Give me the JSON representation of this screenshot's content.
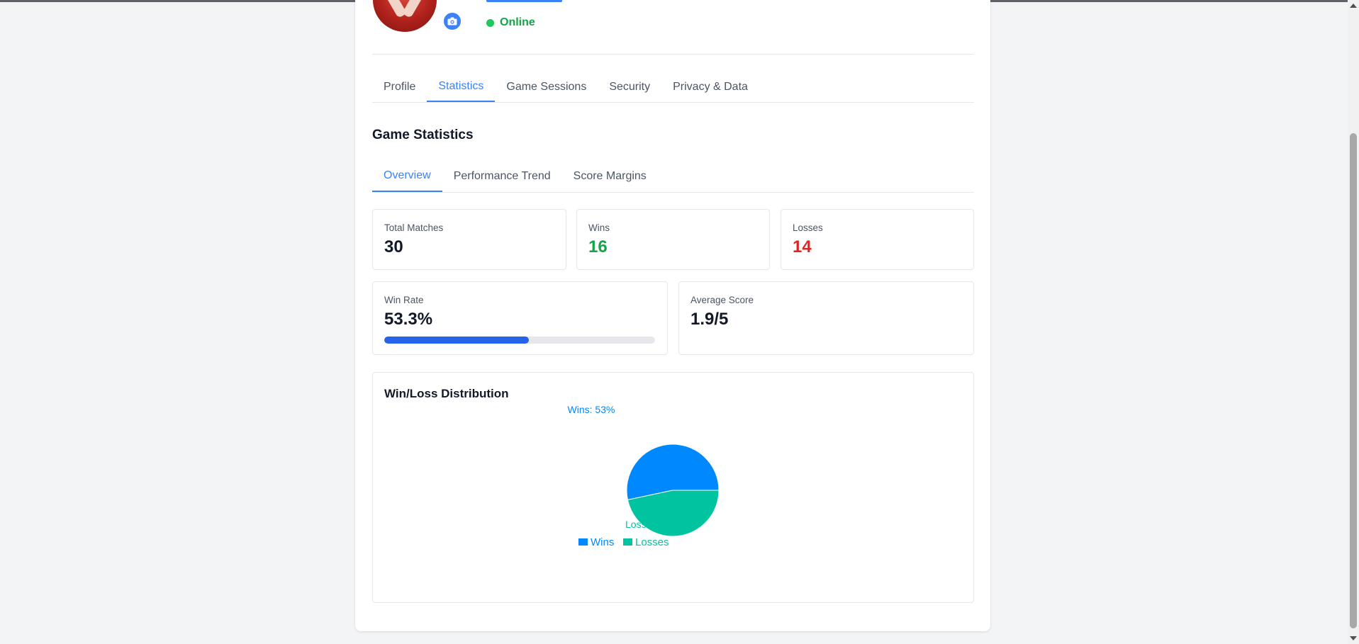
{
  "status": {
    "text": "Online"
  },
  "tabs": [
    {
      "label": "Profile",
      "active": false
    },
    {
      "label": "Statistics",
      "active": true
    },
    {
      "label": "Game Sessions",
      "active": false
    },
    {
      "label": "Security",
      "active": false
    },
    {
      "label": "Privacy & Data",
      "active": false
    }
  ],
  "statistics": {
    "title": "Game Statistics",
    "subtabs": [
      {
        "label": "Overview",
        "active": true
      },
      {
        "label": "Performance Trend",
        "active": false
      },
      {
        "label": "Score Margins",
        "active": false
      }
    ],
    "total_matches": {
      "label": "Total Matches",
      "value": "30"
    },
    "wins": {
      "label": "Wins",
      "value": "16"
    },
    "losses": {
      "label": "Losses",
      "value": "14"
    },
    "win_rate": {
      "label": "Win Rate",
      "value": "53.3%",
      "fraction": 0.533
    },
    "average_score": {
      "label": "Average Score",
      "value": "1.9/5"
    }
  },
  "chart_data": {
    "type": "pie",
    "title": "Win/Loss Distribution",
    "categories": [
      "Wins",
      "Losses"
    ],
    "values": [
      16,
      14
    ],
    "slice_labels": [
      "Wins: 53%",
      "Losses: 47%"
    ],
    "colors": [
      "#0088fe",
      "#00c49f"
    ],
    "legend": [
      "Wins",
      "Losses"
    ],
    "legend_position": "bottom"
  },
  "colors": {
    "accent": "#3b82f6",
    "online": "#22c55e",
    "win": "#16a34a",
    "loss": "#dc2626",
    "progress": "#2563eb"
  },
  "icons": {
    "camera": "camera-icon",
    "status": "online-dot-icon"
  }
}
